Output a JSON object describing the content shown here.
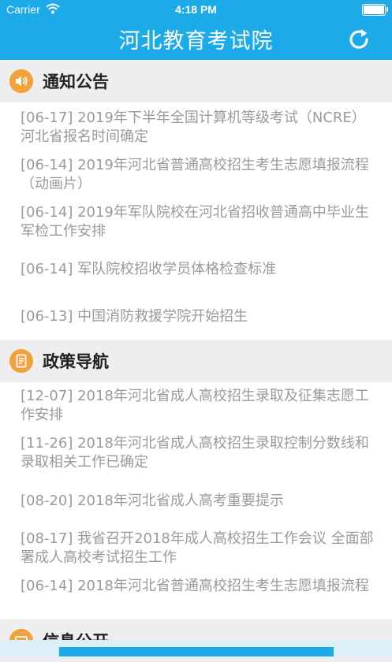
{
  "status_bar": {
    "carrier": "Carrier",
    "time": "4:18 PM",
    "battery_level": 1.0
  },
  "header": {
    "title": "河北教育考试院"
  },
  "sections": {
    "notices": {
      "title": "通知公告",
      "items": [
        "[06-17] 2019年下半年全国计算机等级考试（NCRE）河北省报名时间确定",
        "[06-14] 2019年河北省普通高校招生考生志愿填报流程（动画片）",
        "[06-14] 2019年军队院校在河北省招收普通高中毕业生军检工作安排",
        "[06-14] 军队院校招收学员体格检查标准",
        "[06-13] 中国消防救援学院开始招生"
      ]
    },
    "policy": {
      "title": "政策导航",
      "items": [
        "[12-07] 2018年河北省成人高校招生录取及征集志愿工作安排",
        "[11-26] 2018年河北省成人高校招生录取控制分数线和录取相关工作已确定",
        "[08-20] 2018年河北省成人高考重要提示",
        "[08-17] 我省召开2018年成人高校招生工作会议 全面部署成人高校考试招生工作",
        "[06-14] 2018年河北省普通高校招生考生志愿填报流程"
      ]
    },
    "info": {
      "title": "信息公开"
    }
  },
  "colors": {
    "header": "#1DAAE8",
    "section_bg": "#EEEEF1",
    "icon": "#F2A23A",
    "item_text": "#9A9A9A"
  }
}
